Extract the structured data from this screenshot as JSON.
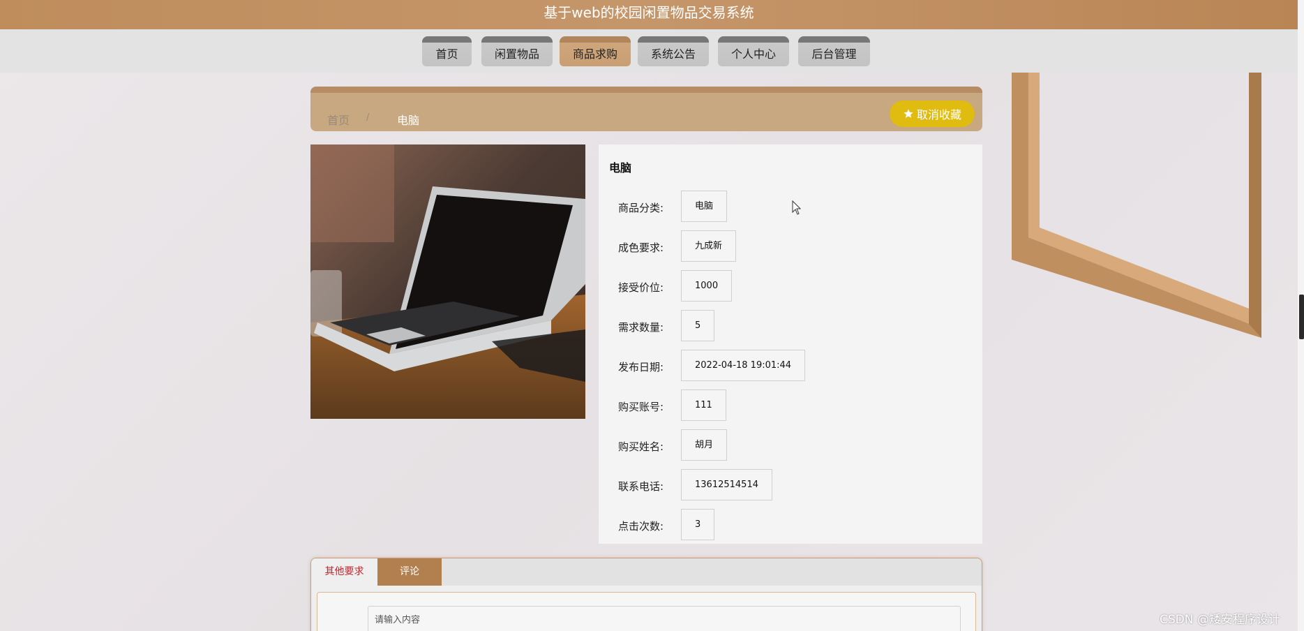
{
  "header": {
    "title": "基于web的校园闲置物品交易系统"
  },
  "nav": {
    "items": [
      {
        "label": "首页"
      },
      {
        "label": "闲置物品"
      },
      {
        "label": "商品求购"
      },
      {
        "label": "系统公告"
      },
      {
        "label": "个人中心"
      },
      {
        "label": "后台管理"
      }
    ],
    "active_index": 2
  },
  "breadcrumb": {
    "home": "首页",
    "separator": "/",
    "current": "电脑"
  },
  "favorite": {
    "label": "取消收藏",
    "icon": "star-icon"
  },
  "product": {
    "title": "电脑",
    "image_icon": "laptop-photo",
    "fields": [
      {
        "label": "商品分类:",
        "value": "电脑"
      },
      {
        "label": "成色要求:",
        "value": "九成新"
      },
      {
        "label": "接受价位:",
        "value": "1000"
      },
      {
        "label": "需求数量:",
        "value": "5"
      },
      {
        "label": "发布日期:",
        "value": "2022-04-18 19:01:44"
      },
      {
        "label": "购买账号:",
        "value": "111"
      },
      {
        "label": "购买姓名:",
        "value": "胡月"
      },
      {
        "label": "联系电话:",
        "value": "13612514514"
      },
      {
        "label": "点击次数:",
        "value": "3"
      }
    ]
  },
  "tabs": {
    "items": [
      {
        "label": "其他要求"
      },
      {
        "label": "评论"
      }
    ],
    "comment_placeholder": "请输入内容"
  },
  "watermark": "CSDN @矮安程序设计",
  "colors": {
    "brand": "#bf8d5c",
    "nav_active": "#cfa67c",
    "favorite_button": "#e0bb10",
    "tab_active_text": "#c0272d"
  }
}
